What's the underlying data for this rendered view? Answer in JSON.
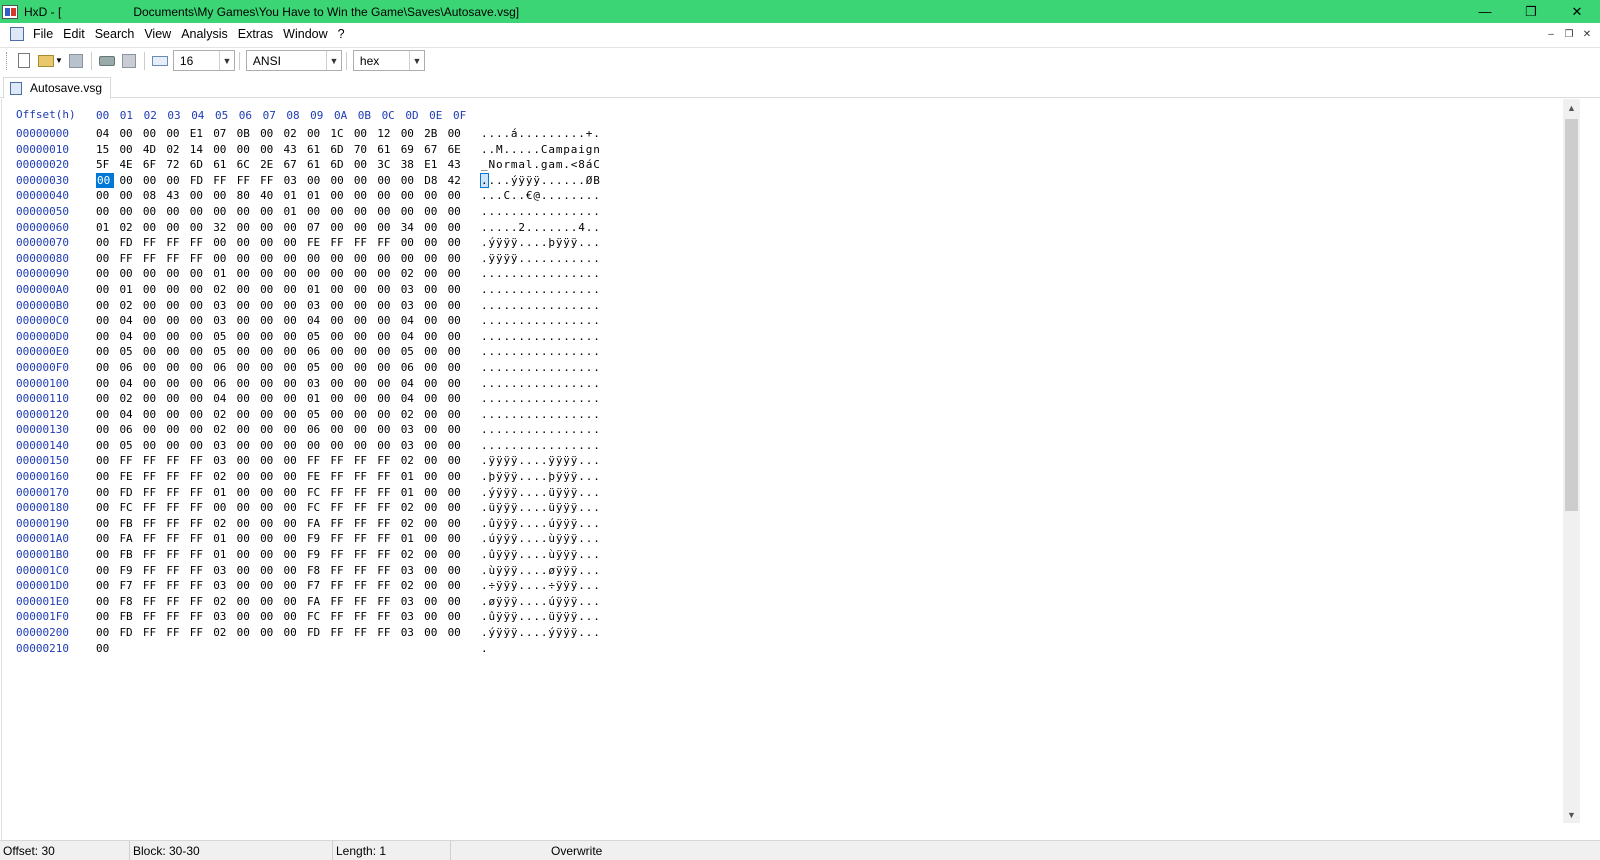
{
  "titlebar": {
    "app_name": "HxD - [",
    "path": "Documents\\My Games\\You Have to Win the Game\\Saves\\Autosave.vsg]",
    "minimize": "—",
    "restore": "❐",
    "close": "✕"
  },
  "menu": {
    "items": [
      "File",
      "Edit",
      "Search",
      "View",
      "Analysis",
      "Extras",
      "Window",
      "?"
    ],
    "mdi_minimize": "–",
    "mdi_restore": "❐",
    "mdi_close": "✕"
  },
  "toolbar": {
    "bytes_per_row": "16",
    "charset": "ANSI",
    "offset_base": "hex",
    "dropdown_arrow": "▼"
  },
  "tab": {
    "label": "Autosave.vsg"
  },
  "editor": {
    "offset_header": "Offset(h)",
    "column_headers": "00 01 02 03 04 05 06 07 08 09 0A 0B 0C 0D 0E 0F",
    "selected": {
      "row": 3,
      "byte": 0
    },
    "rows": [
      {
        "offset": "00000000",
        "hex": "04 00 00 00 E1 07 0B 00 02 00 1C 00 12 00 2B 00",
        "text": "....á.........+."
      },
      {
        "offset": "00000010",
        "hex": "15 00 4D 02 14 00 00 00 43 61 6D 70 61 69 67 6E",
        "text": "..M.....Campaign"
      },
      {
        "offset": "00000020",
        "hex": "5F 4E 6F 72 6D 61 6C 2E 67 61 6D 00 3C 38 E1 43",
        "text": "_Normal.gam.<8áC"
      },
      {
        "offset": "00000030",
        "hex": "00 00 00 00 FD FF FF FF 03 00 00 00 00 00 D8 42",
        "text": "....ýÿÿÿ......ØB"
      },
      {
        "offset": "00000040",
        "hex": "00 00 08 43 00 00 80 40 01 01 00 00 00 00 00 00",
        "text": "...C..€@........"
      },
      {
        "offset": "00000050",
        "hex": "00 00 00 00 00 00 00 00 01 00 00 00 00 00 00 00",
        "text": "................"
      },
      {
        "offset": "00000060",
        "hex": "01 02 00 00 00 32 00 00 00 07 00 00 00 34 00 00",
        "text": ".....2.......4.."
      },
      {
        "offset": "00000070",
        "hex": "00 FD FF FF FF 00 00 00 00 FE FF FF FF 00 00 00",
        "text": ".ýÿÿÿ....þÿÿÿ..."
      },
      {
        "offset": "00000080",
        "hex": "00 FF FF FF FF 00 00 00 00 00 00 00 00 00 00 00",
        "text": ".ÿÿÿÿ..........."
      },
      {
        "offset": "00000090",
        "hex": "00 00 00 00 00 01 00 00 00 00 00 00 00 02 00 00",
        "text": "................"
      },
      {
        "offset": "000000A0",
        "hex": "00 01 00 00 00 02 00 00 00 01 00 00 00 03 00 00",
        "text": "................"
      },
      {
        "offset": "000000B0",
        "hex": "00 02 00 00 00 03 00 00 00 03 00 00 00 03 00 00",
        "text": "................"
      },
      {
        "offset": "000000C0",
        "hex": "00 04 00 00 00 03 00 00 00 04 00 00 00 04 00 00",
        "text": "................"
      },
      {
        "offset": "000000D0",
        "hex": "00 04 00 00 00 05 00 00 00 05 00 00 00 04 00 00",
        "text": "................"
      },
      {
        "offset": "000000E0",
        "hex": "00 05 00 00 00 05 00 00 00 06 00 00 00 05 00 00",
        "text": "................"
      },
      {
        "offset": "000000F0",
        "hex": "00 06 00 00 00 06 00 00 00 05 00 00 00 06 00 00",
        "text": "................"
      },
      {
        "offset": "00000100",
        "hex": "00 04 00 00 00 06 00 00 00 03 00 00 00 04 00 00",
        "text": "................"
      },
      {
        "offset": "00000110",
        "hex": "00 02 00 00 00 04 00 00 00 01 00 00 00 04 00 00",
        "text": "................"
      },
      {
        "offset": "00000120",
        "hex": "00 04 00 00 00 02 00 00 00 05 00 00 00 02 00 00",
        "text": "................"
      },
      {
        "offset": "00000130",
        "hex": "00 06 00 00 00 02 00 00 00 06 00 00 00 03 00 00",
        "text": "................"
      },
      {
        "offset": "00000140",
        "hex": "00 05 00 00 00 03 00 00 00 00 00 00 00 03 00 00",
        "text": "................"
      },
      {
        "offset": "00000150",
        "hex": "00 FF FF FF FF 03 00 00 00 FF FF FF FF 02 00 00",
        "text": ".ÿÿÿÿ....ÿÿÿÿ..."
      },
      {
        "offset": "00000160",
        "hex": "00 FE FF FF FF 02 00 00 00 FE FF FF FF 01 00 00",
        "text": ".þÿÿÿ....þÿÿÿ..."
      },
      {
        "offset": "00000170",
        "hex": "00 FD FF FF FF 01 00 00 00 FC FF FF FF 01 00 00",
        "text": ".ýÿÿÿ....üÿÿÿ..."
      },
      {
        "offset": "00000180",
        "hex": "00 FC FF FF FF 00 00 00 00 FC FF FF FF 02 00 00",
        "text": ".üÿÿÿ....üÿÿÿ..."
      },
      {
        "offset": "00000190",
        "hex": "00 FB FF FF FF 02 00 00 00 FA FF FF FF 02 00 00",
        "text": ".ûÿÿÿ....úÿÿÿ..."
      },
      {
        "offset": "000001A0",
        "hex": "00 FA FF FF FF 01 00 00 00 F9 FF FF FF 01 00 00",
        "text": ".úÿÿÿ....ùÿÿÿ..."
      },
      {
        "offset": "000001B0",
        "hex": "00 FB FF FF FF 01 00 00 00 F9 FF FF FF 02 00 00",
        "text": ".ûÿÿÿ....ùÿÿÿ..."
      },
      {
        "offset": "000001C0",
        "hex": "00 F9 FF FF FF 03 00 00 00 F8 FF FF FF 03 00 00",
        "text": ".ùÿÿÿ....øÿÿÿ..."
      },
      {
        "offset": "000001D0",
        "hex": "00 F7 FF FF FF 03 00 00 00 F7 FF FF FF 02 00 00",
        "text": ".÷ÿÿÿ....÷ÿÿÿ..."
      },
      {
        "offset": "000001E0",
        "hex": "00 F8 FF FF FF 02 00 00 00 FA FF FF FF 03 00 00",
        "text": ".øÿÿÿ....úÿÿÿ..."
      },
      {
        "offset": "000001F0",
        "hex": "00 FB FF FF FF 03 00 00 00 FC FF FF FF 03 00 00",
        "text": ".ûÿÿÿ....üÿÿÿ..."
      },
      {
        "offset": "00000200",
        "hex": "00 FD FF FF FF 02 00 00 00 FD FF FF FF 03 00 00",
        "text": ".ýÿÿÿ....ýÿÿÿ..."
      },
      {
        "offset": "00000210",
        "hex": "00",
        "text": "."
      }
    ]
  },
  "scrollbar": {
    "up_arrow": "▲",
    "down_arrow": "▼"
  },
  "statusbar": {
    "offset": "Offset: 30",
    "block": "Block: 30-30",
    "length": "Length: 1",
    "mode": "Overwrite"
  },
  "colors": {
    "titlebar_bg": "#3bd575",
    "offset_text": "#1e3cb4",
    "selection": "#0078d7"
  }
}
